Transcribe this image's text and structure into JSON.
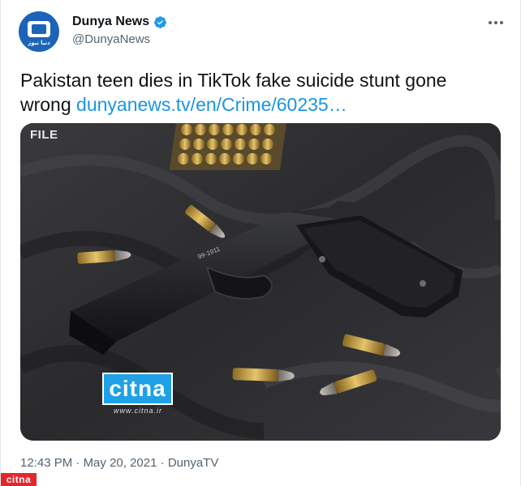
{
  "author": {
    "display_name": "Dunya News",
    "handle": "@DunyaNews",
    "avatar_caption": "دنیا نیوز",
    "verified": true
  },
  "tweet": {
    "text": "Pakistan teen dies in TikTok fake suicide stunt gone wrong ",
    "link": "dunyanews.tv/en/Crime/60235…"
  },
  "media": {
    "label": "FILE",
    "watermark": "citna",
    "watermark_url": "www.citna.ir"
  },
  "meta": {
    "time": "12:43 PM",
    "separator": "·",
    "date": "May 20, 2021",
    "source": "DunyaTV"
  },
  "corner_badge": "citna",
  "colors": {
    "link": "#1b95e0",
    "verified": "#1d9bf0",
    "watermark": "#1ea1e6",
    "corner": "#e3262c"
  },
  "icons": {
    "verified": "verified-badge-icon",
    "more": "more-dots-icon"
  }
}
